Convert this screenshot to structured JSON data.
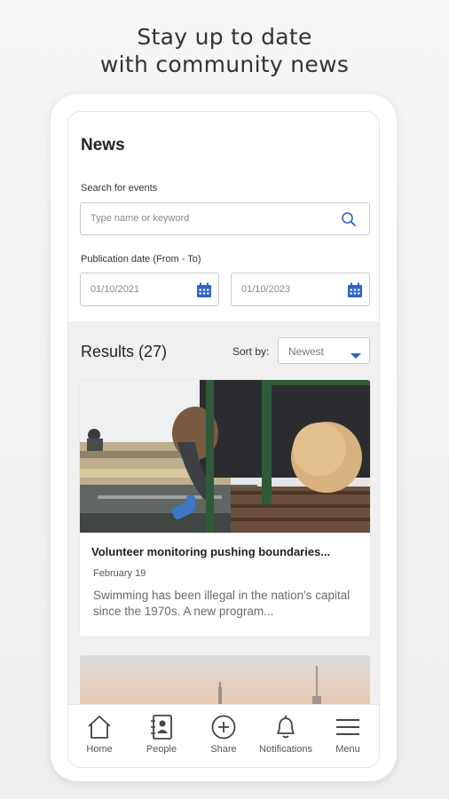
{
  "promo": {
    "line1": "Stay up to date",
    "line2": "with community news"
  },
  "page": {
    "title": "News"
  },
  "search": {
    "label": "Search for events",
    "placeholder": "Type name or keyword"
  },
  "dates": {
    "label": "Publication date (From - To)",
    "from": "01/10/2021",
    "to": "01/10/2023"
  },
  "results": {
    "label": "Results (27)"
  },
  "sort": {
    "label": "Sort by:",
    "value": "Newest"
  },
  "articles": [
    {
      "title": "Volunteer monitoring pushing boundaries...",
      "date": "February 19",
      "excerpt": "Swimming has been illegal in the nation's capital since the 1970s. A new program..."
    }
  ],
  "tabs": [
    {
      "label": "Home",
      "icon": "home-icon"
    },
    {
      "label": "People",
      "icon": "people-icon"
    },
    {
      "label": "Share",
      "icon": "plus-circle-icon"
    },
    {
      "label": "Notifications",
      "icon": "bell-icon"
    },
    {
      "label": "Menu",
      "icon": "menu-icon"
    }
  ],
  "colors": {
    "accent": "#2f63c8",
    "text": "#222222",
    "muted": "#8a8a8a"
  }
}
